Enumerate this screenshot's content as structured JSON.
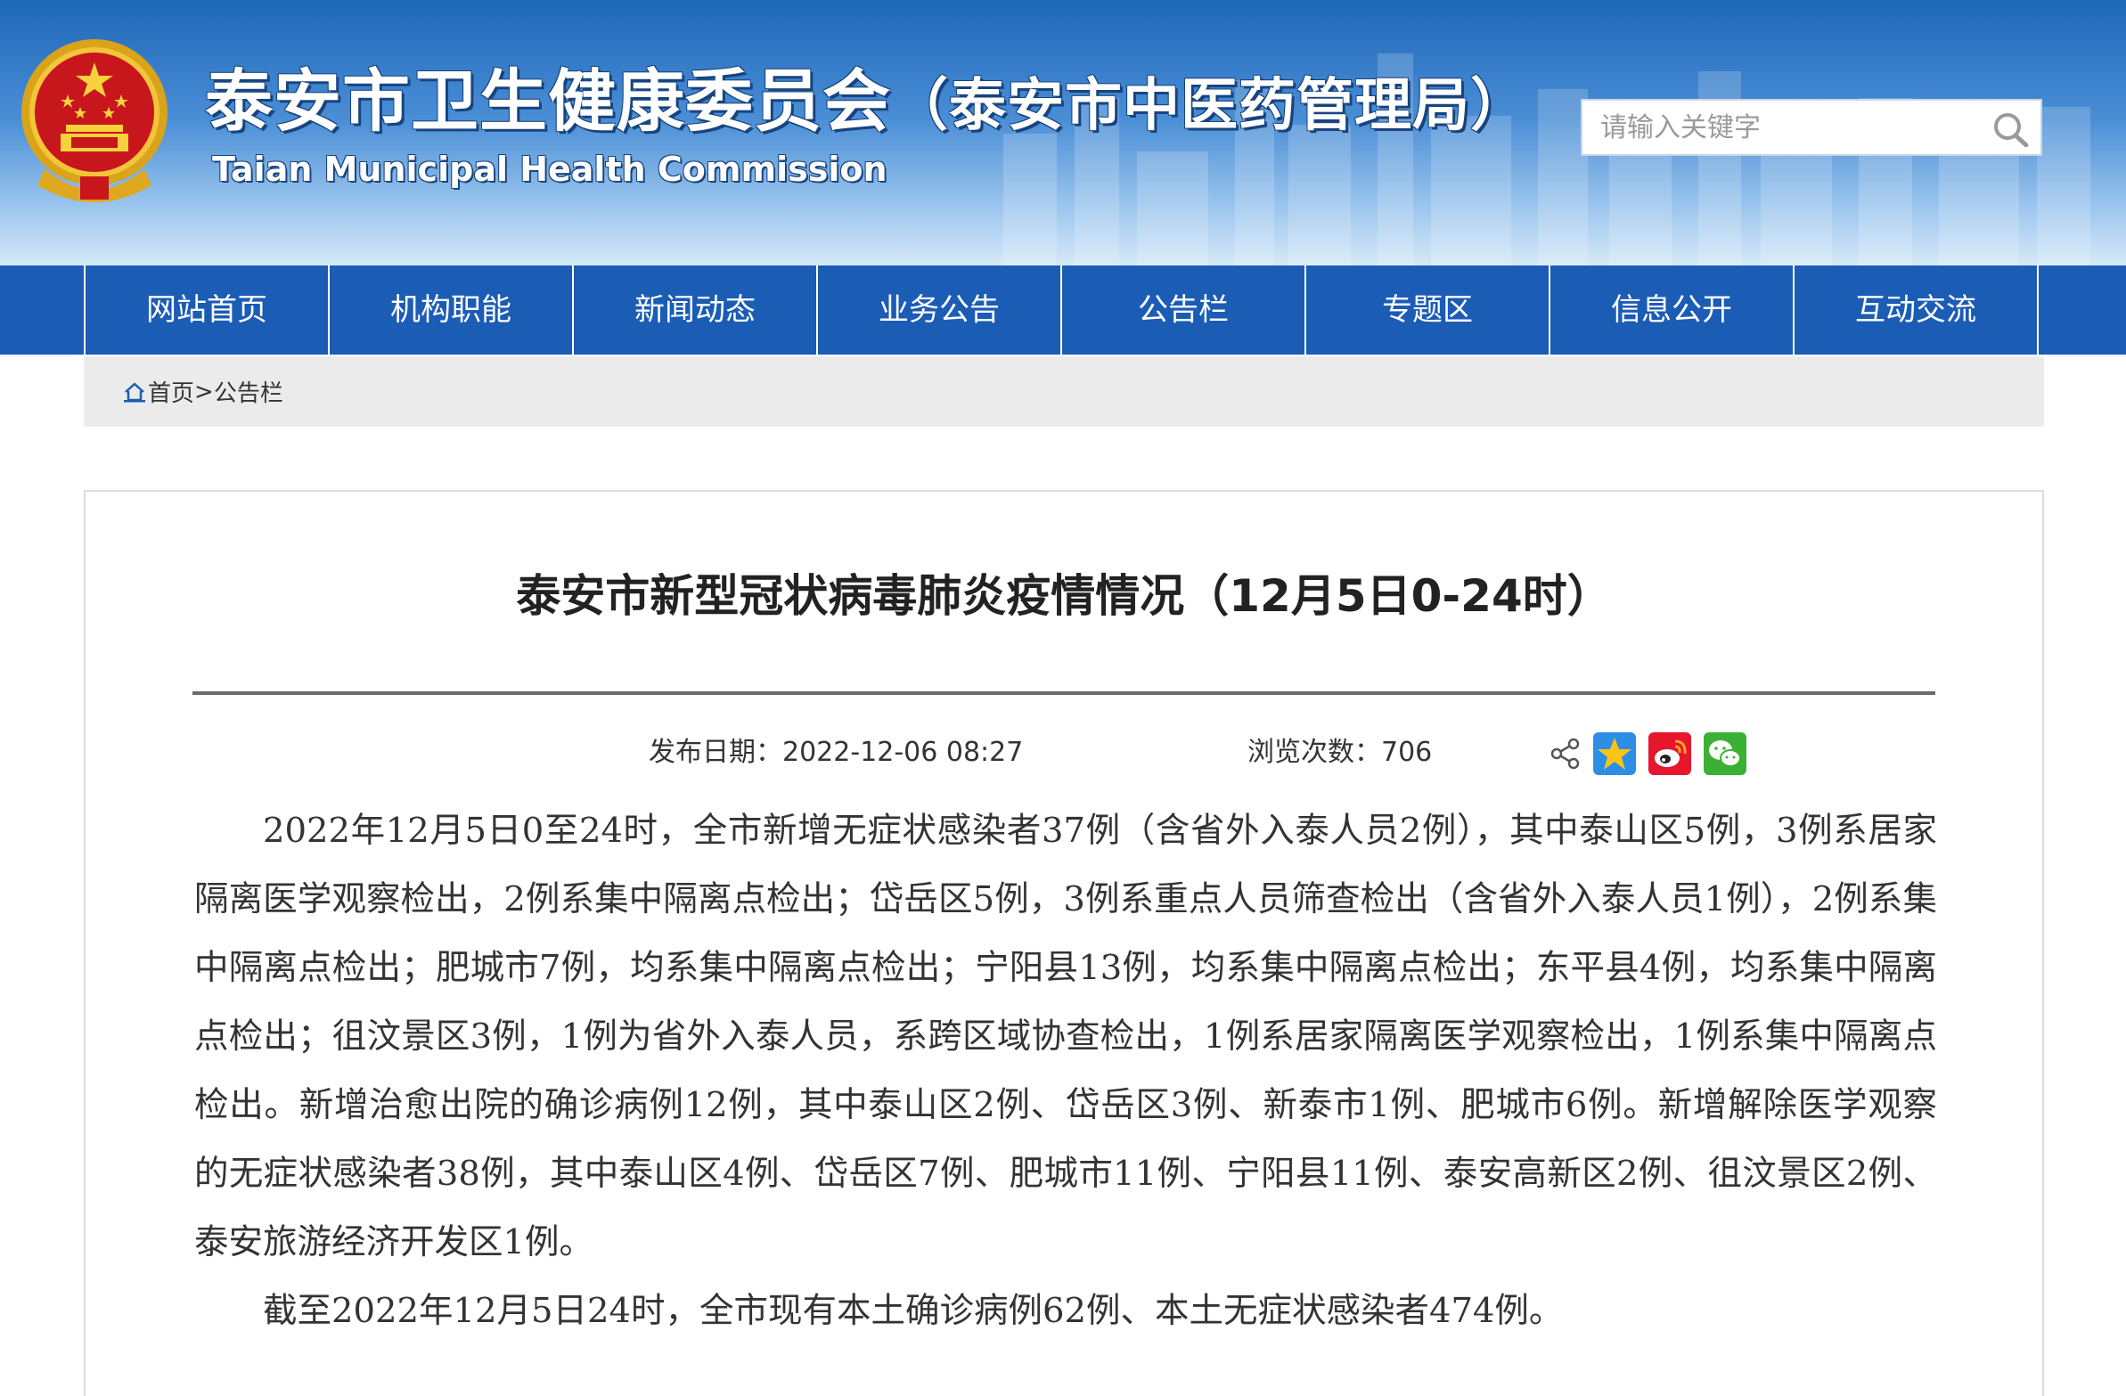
{
  "header": {
    "emblem_icon": "national-emblem-icon",
    "title_cn_main": "泰安市卫生健康委员会",
    "title_cn_sub": "（泰安市中医药管理局）",
    "title_en": "Taian Municipal Health Commission",
    "search": {
      "placeholder": "请输入关键字",
      "icon": "search-icon"
    }
  },
  "nav": {
    "items": [
      {
        "label": "网站首页"
      },
      {
        "label": "机构职能"
      },
      {
        "label": "新闻动态"
      },
      {
        "label": "业务公告"
      },
      {
        "label": "公告栏"
      },
      {
        "label": "专题区"
      },
      {
        "label": "信息公开"
      },
      {
        "label": "互动交流"
      }
    ]
  },
  "breadcrumb": {
    "home_icon": "home-icon",
    "home_label": "首页",
    "separator": ">",
    "current": " 公告栏"
  },
  "article": {
    "title": "泰安市新型冠状病毒肺炎疫情情况（12月5日0-24时）",
    "publish_date": "发布日期：2022-12-06 08:27",
    "views": "浏览次数：706",
    "share_icons": [
      "share-icon",
      "qzone-icon",
      "weibo-icon",
      "wechat-icon"
    ],
    "paragraphs": [
      "2022年12月5日0至24时，全市新增无症状感染者37例（含省外入泰人员2例），其中泰山区5例，3例系居家隔离医学观察检出，2例系集中隔离点检出；岱岳区5例，3例系重点人员筛查检出（含省外入泰人员1例），2例系集中隔离点检出；肥城市7例，均系集中隔离点检出；宁阳县13例，均系集中隔离点检出；东平县4例，均系集中隔离点检出；徂汶景区3例，1例为省外入泰人员，系跨区域协查检出，1例系居家隔离医学观察检出，1例系集中隔离点检出。新增治愈出院的确诊病例12例，其中泰山区2例、岱岳区3例、新泰市1例、肥城市6例。新增解除医学观察的无症状感染者38例，其中泰山区4例、岱岳区7例、肥城市11例、宁阳县11例、泰安高新区2例、徂汶景区2例、泰安旅游经济开发区1例。",
      "截至2022年12月5日24时，全市现有本土确诊病例62例、本土无症状感染者474例。"
    ]
  },
  "colors": {
    "nav_bg": "#1b5cb5",
    "header_top": "#1f67b8",
    "header_bottom": "#d6e9f8",
    "breadcrumb_bg": "#ebebeb"
  }
}
